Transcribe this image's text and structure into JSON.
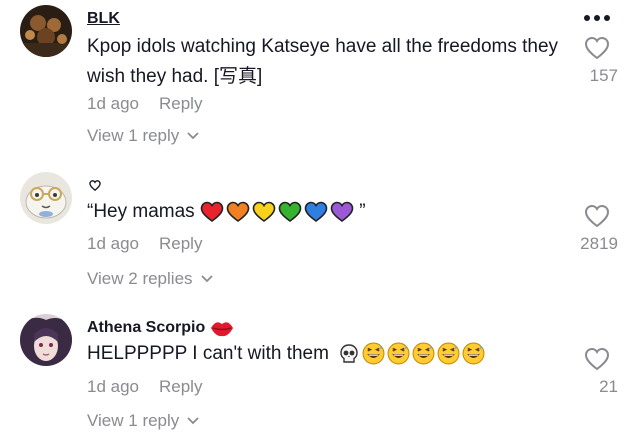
{
  "comments": [
    {
      "username": "BLK",
      "text": "Kpop idols watching Katseye have all the freedoms they wish they had. [写真]",
      "time": "1d ago",
      "reply_label": "Reply",
      "view_replies": "View 1 reply",
      "likes": "157",
      "avatar_icon": "dark-photo-avatar"
    },
    {
      "username": "",
      "username_icon": "small-heart-icon",
      "text_start": "“Hey mamas",
      "text_end": "”",
      "heart_emojis": [
        "#e8232b",
        "#f08022",
        "#f6d21e",
        "#35b32e",
        "#2f7fe0",
        "#9b59d6"
      ],
      "time": "1d ago",
      "reply_label": "Reply",
      "view_replies": "View 2 replies",
      "likes": "2819",
      "avatar_icon": "cartoon-face-avatar"
    },
    {
      "username": "Athena Scorpio",
      "username_emoji": "kiss-lips-emoji",
      "text": "HELPPPPP I can't with them",
      "text_emojis": [
        "skull-emoji",
        "grinning-sweat-emoji",
        "grinning-sweat-emoji",
        "grinning-sweat-emoji",
        "grinning-sweat-emoji",
        "grinning-sweat-emoji"
      ],
      "time": "1d ago",
      "reply_label": "Reply",
      "view_replies": "View 1 reply",
      "likes": "21",
      "avatar_icon": "anime-character-avatar"
    }
  ],
  "colors": {
    "text": "#161823",
    "secondary": "#8a8b91",
    "background": "#ffffff"
  }
}
